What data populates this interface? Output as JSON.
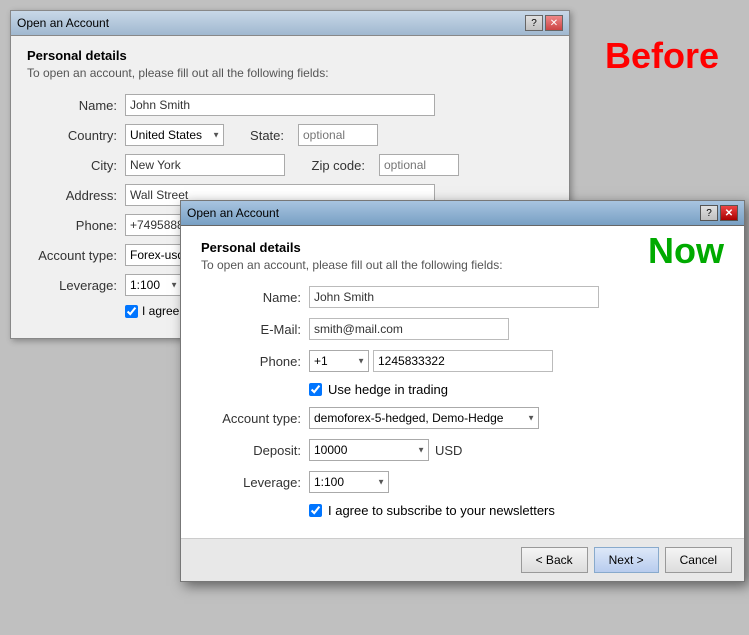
{
  "behind_window": {
    "title": "Open an Account",
    "before_label": "Before",
    "help_btn": "?",
    "close_btn": "✕",
    "section_title": "Personal details",
    "section_subtitle": "To open an account, please fill out all the following fields:",
    "fields": {
      "name_label": "Name:",
      "name_value": "John Smith",
      "country_label": "Country:",
      "country_value": "United States",
      "state_label": "State:",
      "state_placeholder": "optional",
      "city_label": "City:",
      "city_value": "New York",
      "zipcode_label": "Zip code:",
      "zipcode_placeholder": "optional",
      "address_label": "Address:",
      "address_value": "Wall Street",
      "phone_label": "Phone:",
      "phone_value": "+749588833",
      "account_type_label": "Account type:",
      "account_type_value": "Forex-usd",
      "leverage_label": "Leverage:",
      "leverage_value": "1:100",
      "agree_label": "I agree to"
    }
  },
  "front_window": {
    "title": "Open an Account",
    "now_label": "Now",
    "help_btn": "?",
    "close_btn": "✕",
    "section_title": "Personal details",
    "section_subtitle": "To open an account, please fill out all the following fields:",
    "fields": {
      "name_label": "Name:",
      "name_value": "John Smith",
      "email_label": "E-Mail:",
      "email_value": "smith@mail.com",
      "phone_label": "Phone:",
      "phone_code": "+1",
      "phone_number": "1245833322",
      "hedge_label": "Use hedge in trading",
      "account_type_label": "Account type:",
      "account_type_value": "demoforex-5-hedged, Demo-Hedge",
      "deposit_label": "Deposit:",
      "deposit_value": "10000",
      "deposit_currency": "USD",
      "leverage_label": "Leverage:",
      "leverage_value": "1:100",
      "agree_label": "I agree to subscribe to your newsletters"
    },
    "footer": {
      "back_label": "< Back",
      "next_label": "Next >",
      "cancel_label": "Cancel"
    }
  }
}
